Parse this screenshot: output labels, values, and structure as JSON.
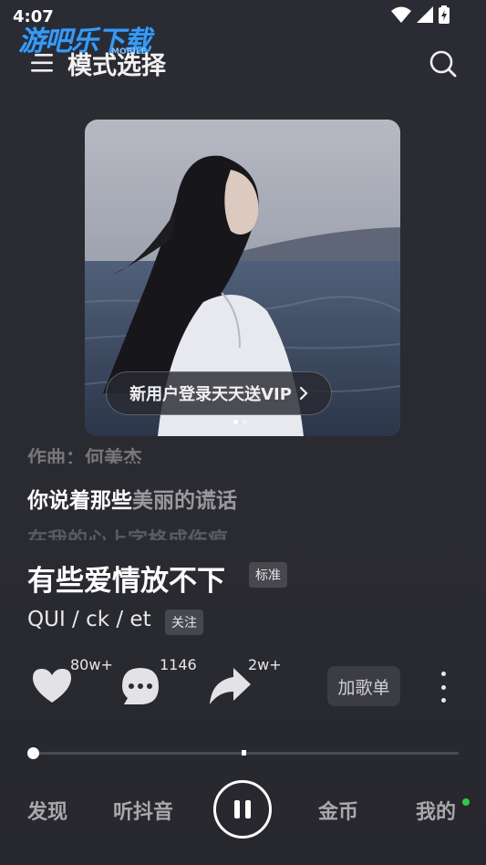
{
  "status_bar": {
    "time": "4:07"
  },
  "watermark": {
    "text": "游吧乐下载",
    "sub": "MOBILE"
  },
  "header": {
    "title": "模式选择"
  },
  "banner": {
    "vip_text": "新用户登录天天送VIP",
    "page_count": 2,
    "active_page": 1
  },
  "lyrics": {
    "line1": "作曲：何美杰",
    "line2_sung": "你说着那些",
    "line2_rest": "美丽的谎话",
    "line3": "在我的心上字格成伤痕"
  },
  "song": {
    "title": "有些爱情放不下",
    "quality_tag": "标准",
    "artist": "QUI / ck / et",
    "follow_label": "关注"
  },
  "actions": {
    "like_count": "80w+",
    "comment_count": "1146",
    "share_count": "2w+",
    "add_playlist_label": "加歌单"
  },
  "progress": {
    "value": 0.0,
    "marker": 0.49
  },
  "nav": {
    "discover": "发现",
    "listen": "听抖音",
    "coins": "金币",
    "mine": "我的"
  },
  "colors": {
    "accent_dot": "#2ecc40",
    "background": "#2b2c33"
  }
}
